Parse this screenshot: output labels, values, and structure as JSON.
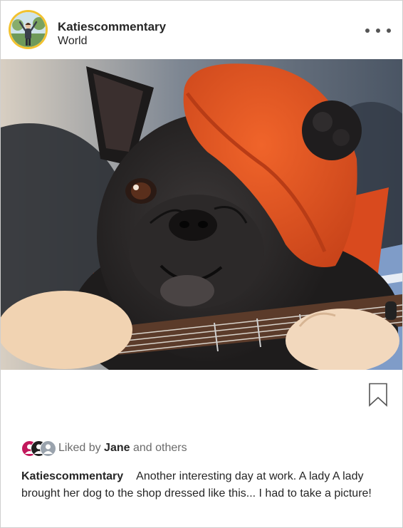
{
  "post": {
    "username": "Katiescommentary",
    "location": "World",
    "more_icon": "ellipsis-horizontal-icon",
    "photo_description_icon": "photo",
    "bookmark_icon": "bookmark-icon"
  },
  "likes": {
    "prefix": "Liked by",
    "name": "Jane",
    "suffix": "and others",
    "avatar_colors": [
      "#c2185b",
      "#1f1f1f",
      "#9aa3ad"
    ]
  },
  "caption": {
    "username": "Katiescommentary",
    "text": "Another interesting day at work. A lady A lady brought her dog to the shop dressed like this... I had to take a picture!"
  },
  "colors": {
    "avatar_ring": "#f2c230",
    "text_primary": "#262626",
    "text_muted": "#6b6b6b"
  }
}
